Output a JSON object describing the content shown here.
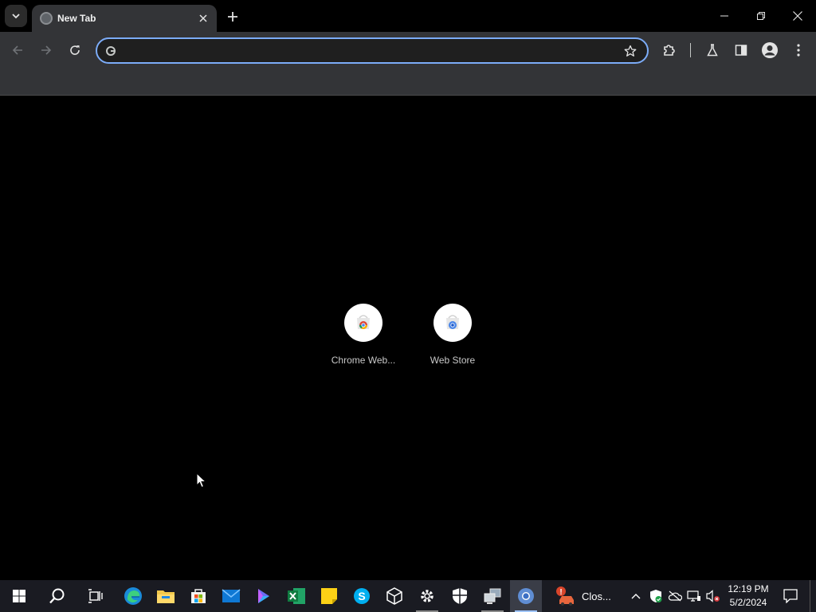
{
  "browser": {
    "tab_title": "New Tab",
    "omnibox": {
      "value": "",
      "placeholder": ""
    }
  },
  "shortcuts": [
    {
      "label": "Chrome Web...",
      "icon": "chrome-web-store-icon"
    },
    {
      "label": "Web Store",
      "icon": "web-store-icon"
    }
  ],
  "taskbar": {
    "apps": [
      "start",
      "search",
      "task-view",
      "edge",
      "file-explorer",
      "microsoft-store",
      "mail",
      "copilot",
      "excel",
      "sticky-notes",
      "skype",
      "3d-viewer",
      "settings",
      "windows-security",
      "network-app",
      "chrome"
    ],
    "closing_label": "Clos...",
    "time": "12:19 PM",
    "date": "5/2/2024"
  },
  "colors": {
    "accent": "#7cacf8",
    "toolbar": "#333437",
    "taskbar": "#1a1b22"
  }
}
